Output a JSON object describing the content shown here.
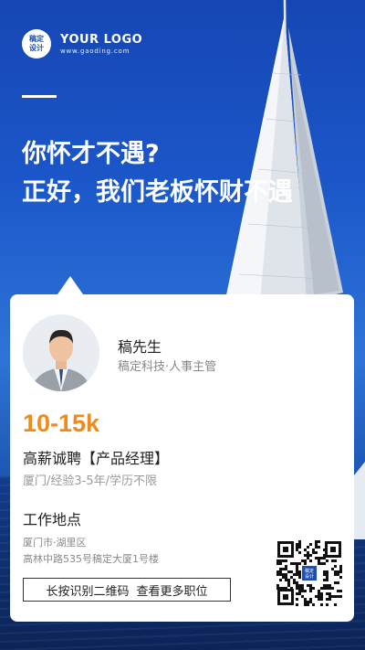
{
  "brand": {
    "badge_line1": "稿定",
    "badge_line2": "设计",
    "name": "YOUR LOGO",
    "url": "www.gaoding.com"
  },
  "headline": {
    "line1": "你怀才不遇?",
    "line2": "正好，我们老板怀财不遇"
  },
  "contact": {
    "name": "稿先生",
    "title": "稿定科技·人事主管"
  },
  "job": {
    "salary": "10-15k",
    "title": "高薪诚聘【产品经理】",
    "meta": "厦门/经验3-5年/学历不限"
  },
  "location": {
    "heading": "工作地点",
    "line1": "厦门市·湖里区",
    "line2": "高林中路535号稿定大厦1号楼"
  },
  "cta": {
    "part1": "长按识别二维码",
    "part2": "查看更多职位"
  },
  "qr": {
    "center_line1": "稿定",
    "center_line2": "设计"
  },
  "colors": {
    "accent": "#f08a1b",
    "brand_blue": "#1c4fb6"
  }
}
